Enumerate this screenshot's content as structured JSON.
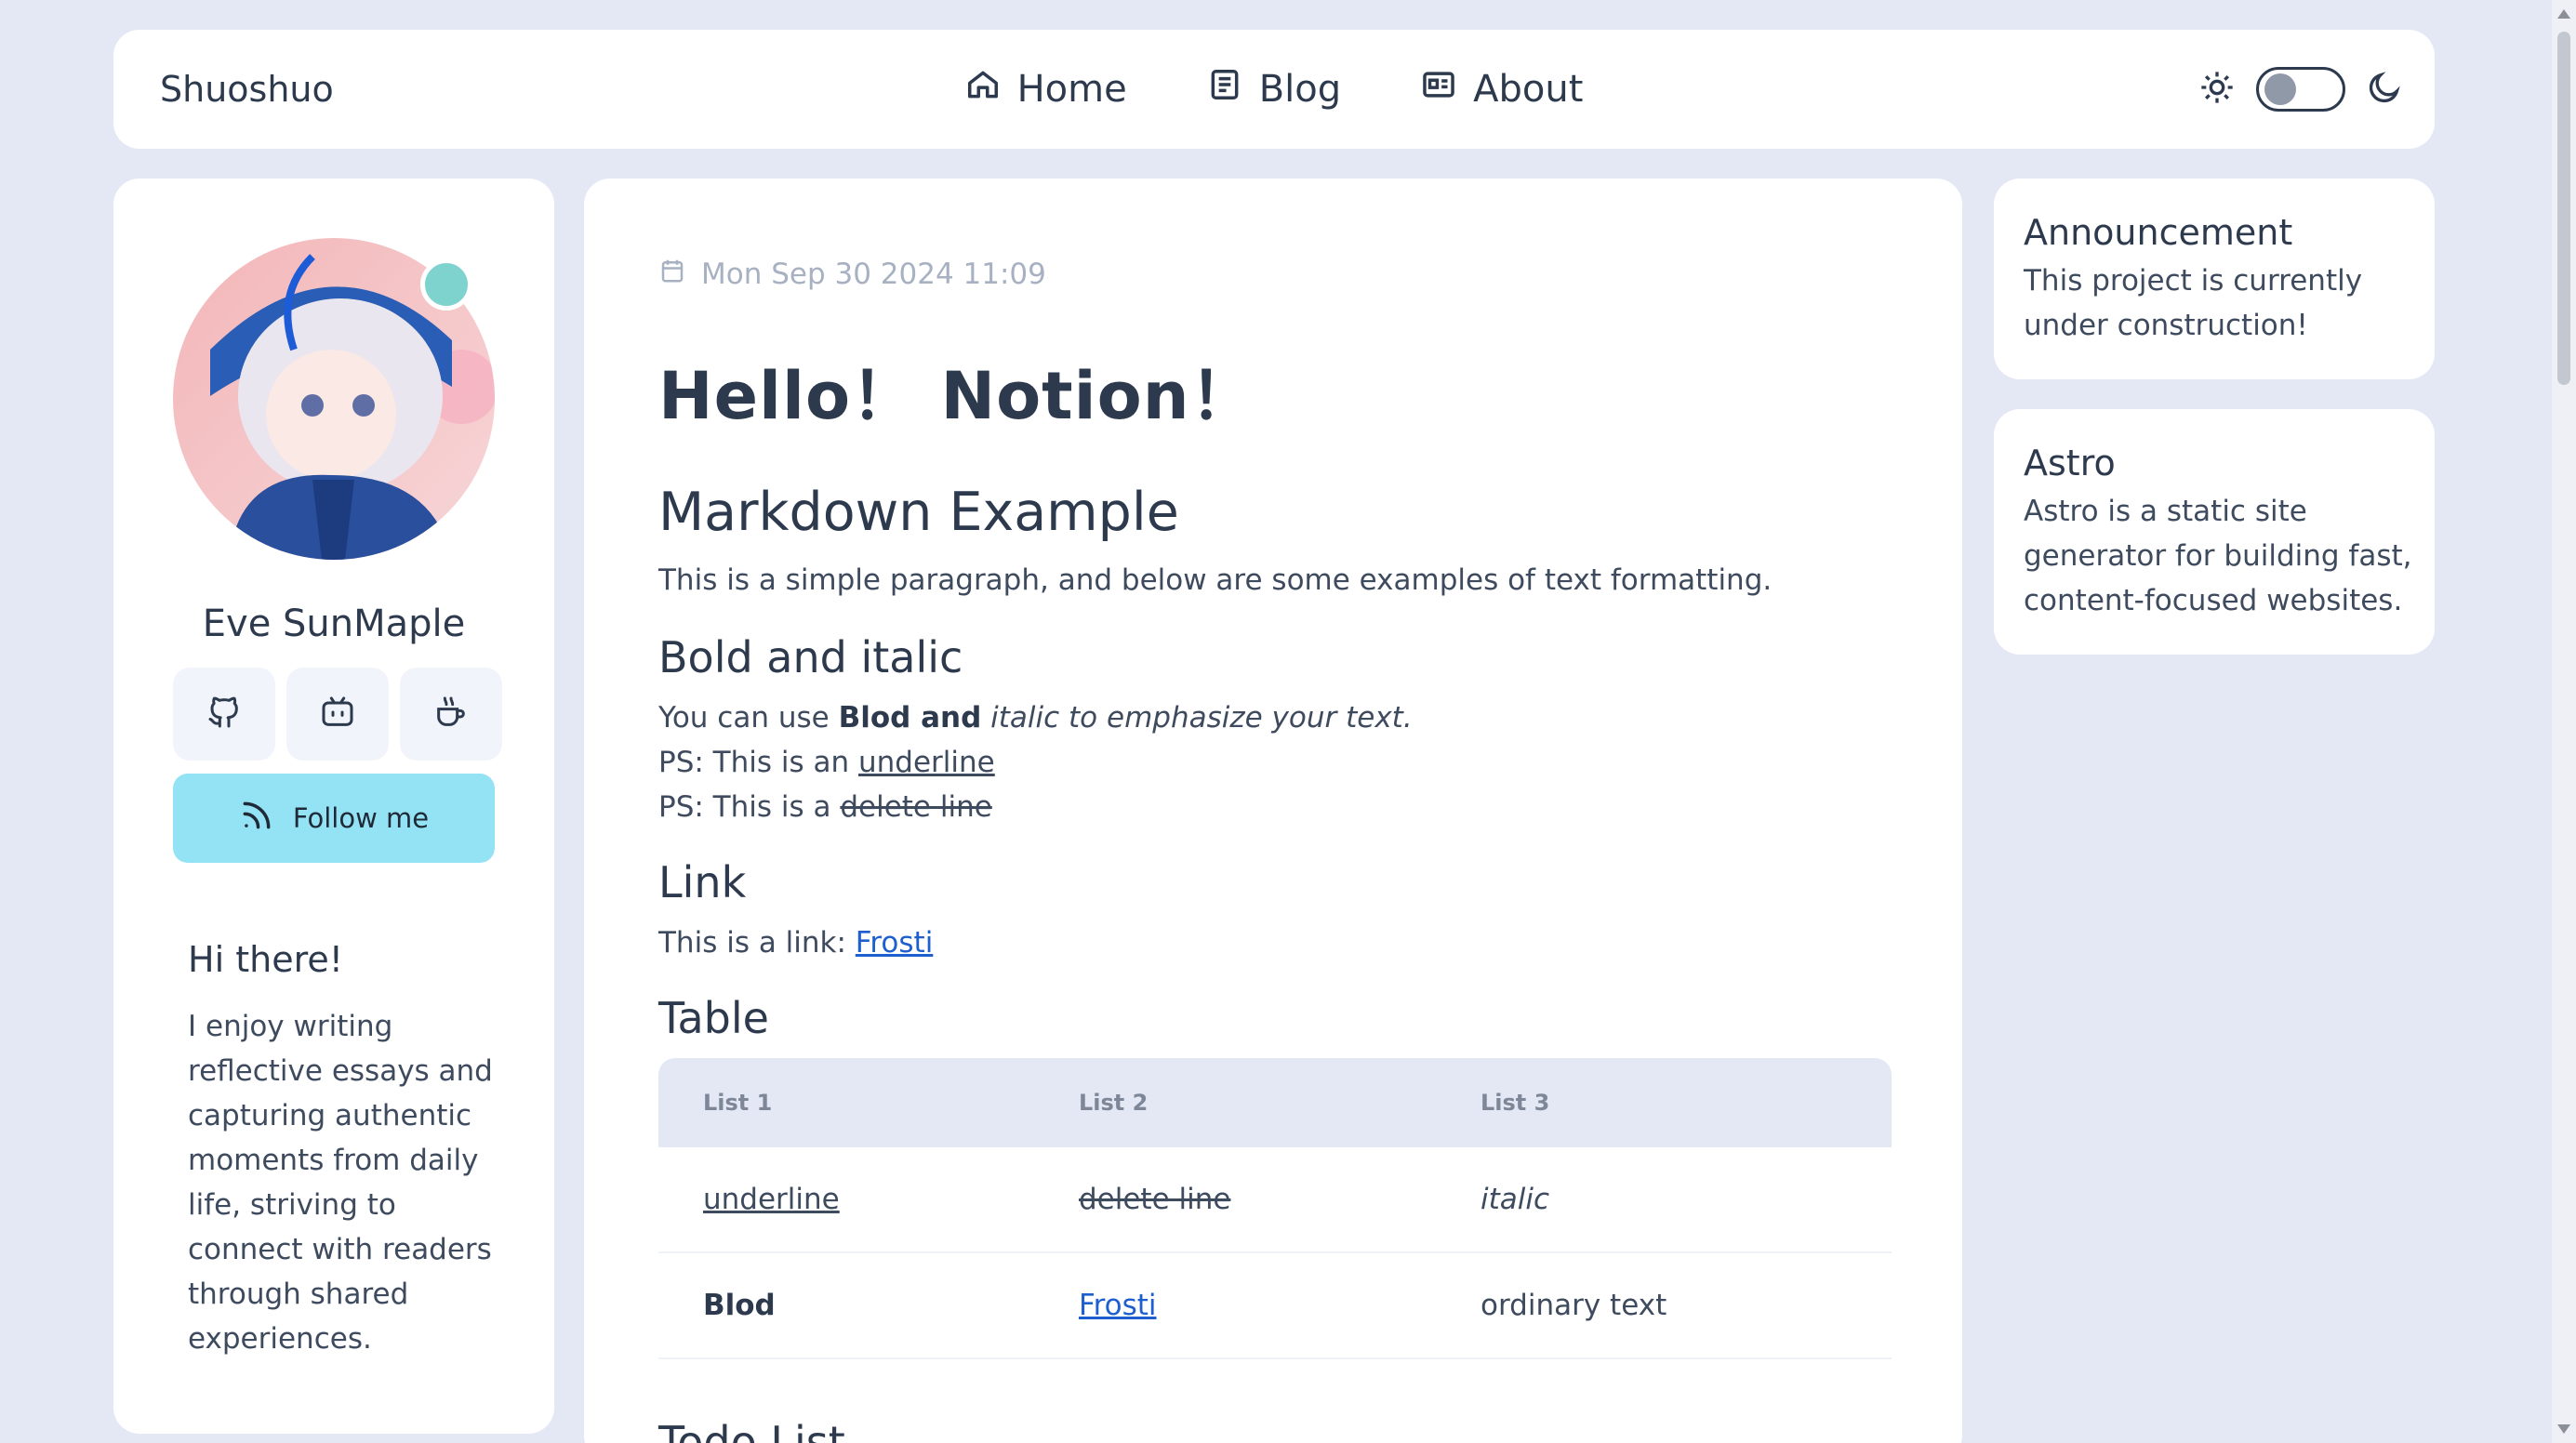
{
  "nav": {
    "brand": "Shuoshuo",
    "links": [
      {
        "label": "Home",
        "icon": "home-icon"
      },
      {
        "label": "Blog",
        "icon": "document-icon"
      },
      {
        "label": "About",
        "icon": "id-card-icon"
      }
    ],
    "theme": {
      "light_icon": "sun-icon",
      "dark_icon": "moon-icon"
    }
  },
  "profile": {
    "name": "Eve SunMaple",
    "socials": [
      "github-icon",
      "bilibili-icon",
      "coffee-icon"
    ],
    "follow_label": "Follow me",
    "hi_title": "Hi there!",
    "hi_text": "I enjoy writing reflective essays and capturing authentic moments from daily life, striving to connect with readers through shared experiences."
  },
  "post": {
    "date": "Mon Sep 30 2024 11:09",
    "title": "Hello！ Notion！",
    "markdown_heading": "Markdown Example",
    "intro": "This is a simple paragraph, and below are some examples of text formatting.",
    "bold_heading": "Bold and italic",
    "bold_line": {
      "prefix": "You can use ",
      "bold": "Blod and",
      "italic": " italic to emphasize your text."
    },
    "underline_line": {
      "prefix": "PS: This is an ",
      "text": "underline"
    },
    "delete_line": {
      "prefix": "PS: This is a ",
      "text": "delete line"
    },
    "link_heading": "Link",
    "link_line": {
      "prefix": "This is a link: ",
      "text": "Frosti"
    },
    "table_heading": "Table",
    "table": {
      "headers": [
        "List 1",
        "List 2",
        "List 3"
      ],
      "rows": [
        [
          "underline",
          "delete line",
          "italic"
        ],
        [
          "Blod",
          "Frosti",
          "ordinary text"
        ]
      ]
    },
    "next_heading_peek": "Todo List"
  },
  "sidebar": {
    "announcement": {
      "title": "Announcement",
      "text": "This project is currently under construction!"
    },
    "astro": {
      "title": "Astro",
      "text": "Astro is a static site generator for building fast, content-focused websites."
    }
  },
  "colors": {
    "background": "#e4e8f5",
    "accent": "#94e3f5",
    "link": "#1d5fcf",
    "status": "#7fd3cf"
  }
}
